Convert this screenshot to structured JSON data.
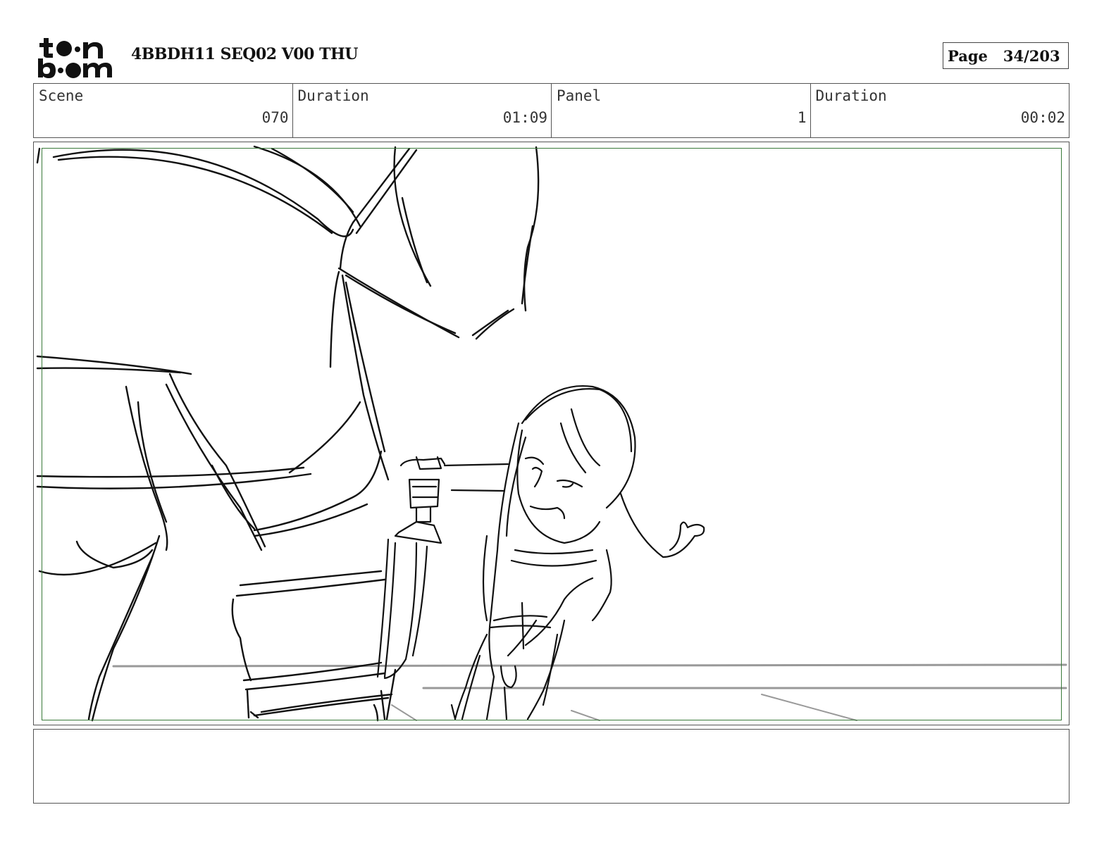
{
  "logo": {
    "line1": "toon",
    "line2": "boom"
  },
  "header": {
    "title": "4BBDH11 SEQ02 V00 THU",
    "page_label": "Page",
    "page_value": "34/203"
  },
  "info": {
    "scene_label": "Scene",
    "scene_value": "070",
    "duration_label": "Duration",
    "duration_value": "01:09",
    "panel_label": "Panel",
    "panel_value": "1",
    "panel_duration_label": "Duration",
    "panel_duration_value": "00:02"
  },
  "notes": {
    "text": ""
  },
  "colors": {
    "safe_frame": "#3a7a3a",
    "ink": "#111111",
    "floor_line": "#999999"
  }
}
